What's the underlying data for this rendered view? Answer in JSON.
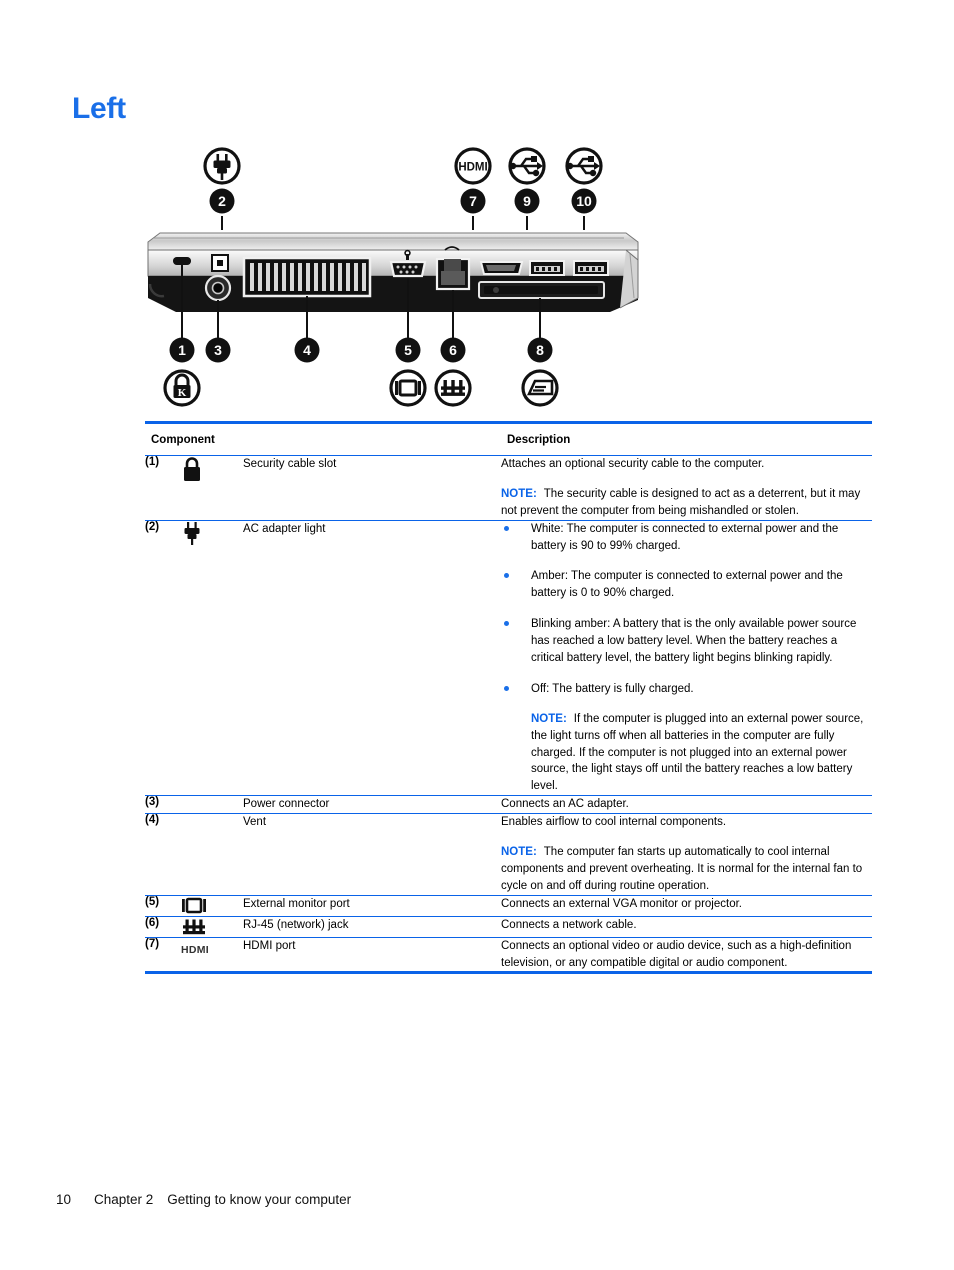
{
  "heading": "Left",
  "figure": {
    "alt": "Left side view of the computer with numbered callouts",
    "callouts": [
      "1",
      "2",
      "3",
      "4",
      "5",
      "6",
      "7",
      "8",
      "9",
      "10"
    ],
    "icon_labels": {
      "hdmi": "HDMI"
    }
  },
  "table": {
    "headers": {
      "component": "Component",
      "description": "Description"
    },
    "rows": [
      {
        "num": "(1)",
        "icon": "lock-icon",
        "name": "Security cable slot",
        "desc_paragraphs": [
          "Attaches an optional security cable to the computer."
        ],
        "note_label": "NOTE:",
        "note_text": "The security cable is designed to act as a deterrent, but it may not prevent the computer from being mishandled or stolen."
      },
      {
        "num": "(2)",
        "icon": "ac-adapter-icon",
        "name": "AC adapter light",
        "bullets": [
          "White: The computer is connected to external power and the battery is 90 to 99% charged.",
          "Amber: The computer is connected to external power and the battery is 0 to 90% charged.",
          "Blinking amber: A battery that is the only available power source has reached a low battery level. When the battery reaches a critical battery level, the battery light begins blinking rapidly.",
          "Off: The battery is fully charged."
        ],
        "note_label": "NOTE:",
        "note_text": "If the computer is plugged into an external power source, the light turns off when all batteries in the computer are fully charged. If the computer is not plugged into an external power source, the light stays off until the battery reaches a low battery level."
      },
      {
        "num": "(3)",
        "icon": "",
        "name": "Power connector",
        "desc_paragraphs": [
          "Connects an AC adapter."
        ]
      },
      {
        "num": "(4)",
        "icon": "",
        "name": "Vent",
        "desc_paragraphs": [
          "Enables airflow to cool internal components."
        ],
        "note_label": "NOTE:",
        "note_text": "The computer fan starts up automatically to cool internal components and prevent overheating. It is normal for the internal fan to cycle on and off during routine operation."
      },
      {
        "num": "(5)",
        "icon": "monitor-icon",
        "name": "External monitor port",
        "desc_paragraphs": [
          "Connects an external VGA monitor or projector."
        ]
      },
      {
        "num": "(6)",
        "icon": "rj45-icon",
        "name": "RJ-45 (network) jack",
        "desc_paragraphs": [
          "Connects a network cable."
        ]
      },
      {
        "num": "(7)",
        "icon": "hdmi-icon",
        "icon_text": "HDMI",
        "name": "HDMI port",
        "desc_paragraphs": [
          "Connects an optional video or audio device, such as a high-definition television, or any compatible digital or audio component."
        ]
      }
    ]
  },
  "footer": {
    "page_number": "10",
    "chapter": "Chapter 2",
    "chapter_title": "Getting to know your computer"
  },
  "colors": {
    "accent_blue": "#0a63e8",
    "heading_blue": "#1a6fe8"
  }
}
